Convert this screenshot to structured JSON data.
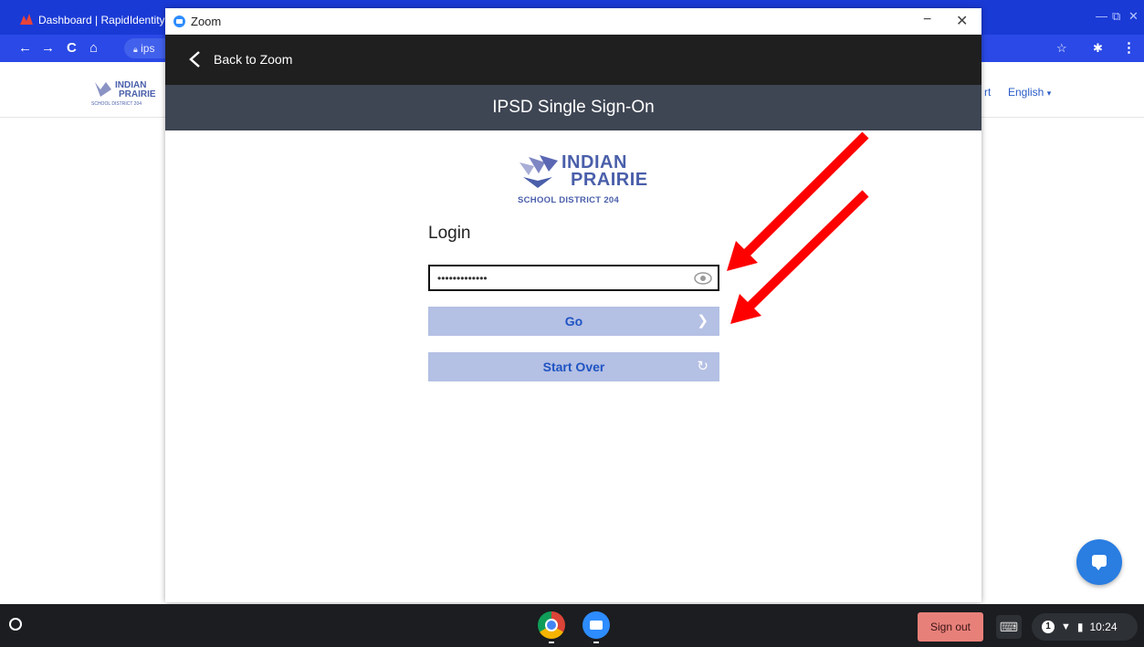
{
  "browser": {
    "tab_title": "Dashboard | RapidIdentity",
    "omnibox_text": "ips",
    "bg_link_partial": "rt",
    "language": "English"
  },
  "zoom_window": {
    "title": "Zoom",
    "minimize": "−",
    "close": "✕",
    "back_label": "Back to Zoom"
  },
  "sso": {
    "header_title": "IPSD Single Sign-On",
    "logo": {
      "line1": "INDIAN",
      "line2": "PRAIRIE",
      "line3": "SCHOOL DISTRICT 204"
    },
    "login_label": "Login",
    "password_value": "•••••••••••••",
    "go_label": "Go",
    "go_icon": "chevron-right-icon",
    "start_over_label": "Start Over",
    "start_over_icon": "refresh-icon"
  },
  "annotations": {
    "arrow_color": "#ff0000",
    "arrow_count": 2
  },
  "shelf": {
    "apps": [
      "chrome-icon",
      "zoom-icon"
    ],
    "sign_out_label": "Sign out",
    "notification_count": "1",
    "time": "10:24"
  },
  "colors": {
    "chrome_tabstrip": "#1a3ad6",
    "sso_header": "#3e4553",
    "button_bg": "#b4c0e4",
    "button_text": "#1f54c2",
    "logo": "#4a5faa",
    "sign_out_bg": "#e8807a",
    "chat_fab": "#2a7de1"
  }
}
